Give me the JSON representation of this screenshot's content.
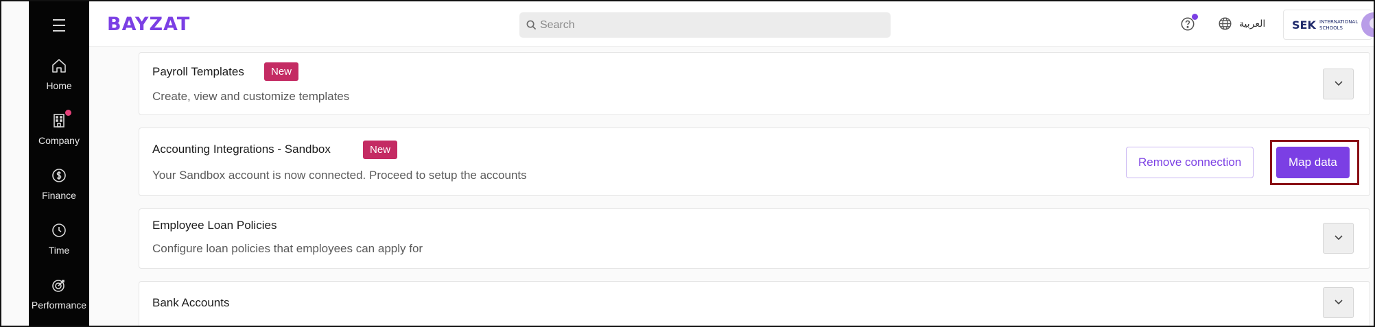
{
  "brand": {
    "logo_text": "BAYZAT",
    "accent": "#7b3fe4"
  },
  "sidebar": {
    "items": [
      {
        "label": "Home",
        "icon": "home-icon"
      },
      {
        "label": "Company",
        "icon": "building-icon",
        "has_notification": true
      },
      {
        "label": "Finance",
        "icon": "dollar-icon"
      },
      {
        "label": "Time",
        "icon": "clock-icon"
      },
      {
        "label": "Performance",
        "icon": "target-icon"
      }
    ]
  },
  "topbar": {
    "search_placeholder": "Search",
    "language_label": "العربية",
    "org_logo_main": "SEK",
    "org_logo_sub1": "INTERNATIONAL",
    "org_logo_sub2": "SCHOOLS"
  },
  "cards": [
    {
      "title": "Payroll Templates",
      "badge": "New",
      "description": "Create, view and customize templates"
    },
    {
      "title": "Accounting Integrations - Sandbox",
      "badge": "New",
      "description": "Your Sandbox account is now connected. Proceed to setup the accounts",
      "secondary_action": "Remove connection",
      "primary_action": "Map data"
    },
    {
      "title": "Employee Loan Policies",
      "description": "Configure loan policies that employees can apply for"
    },
    {
      "title": "Bank Accounts"
    }
  ],
  "colors": {
    "badge": "#c42b63",
    "highlight_border": "#8a1016",
    "sidebar_bg": "#050505"
  }
}
